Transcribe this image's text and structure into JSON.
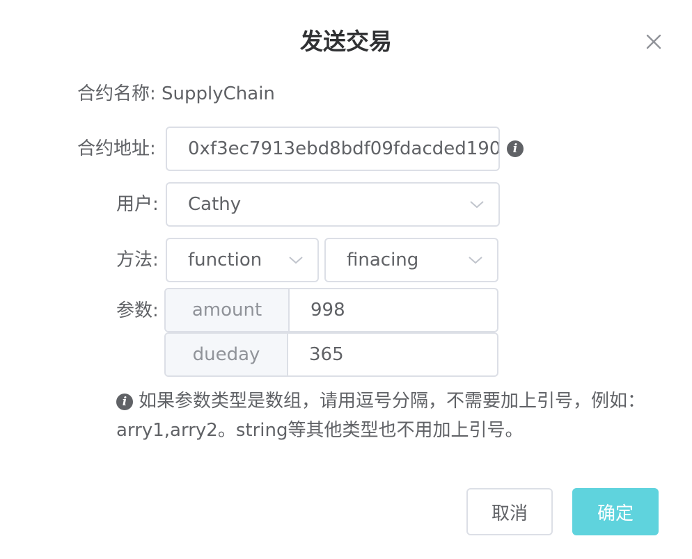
{
  "dialog": {
    "title": "发送交易"
  },
  "contract": {
    "name_label": "合约名称:",
    "name_value": "SupplyChain",
    "address_label": "合约地址:",
    "address_value": "0xf3ec7913ebd8bdf09fdacded190"
  },
  "user": {
    "label": "用户:",
    "selected": "Cathy"
  },
  "method": {
    "label": "方法:",
    "type_selected": "function",
    "name_selected": "finacing"
  },
  "params": {
    "label": "参数:",
    "items": [
      {
        "key": "amount",
        "value": "998"
      },
      {
        "key": "dueday",
        "value": "365"
      }
    ]
  },
  "note": {
    "text": "如果参数类型是数组，请用逗号分隔，不需要加上引号，例如：arry1,arry2。string等其他类型也不用加上引号。"
  },
  "footer": {
    "cancel_label": "取消",
    "confirm_label": "确定"
  },
  "icons": {
    "close": "close-icon",
    "info": "info-icon",
    "chevron": "chevron-down-icon"
  },
  "colors": {
    "primary": "#5fd3dd",
    "border": "#dcdfe6",
    "text": "#606266",
    "title": "#303133"
  }
}
